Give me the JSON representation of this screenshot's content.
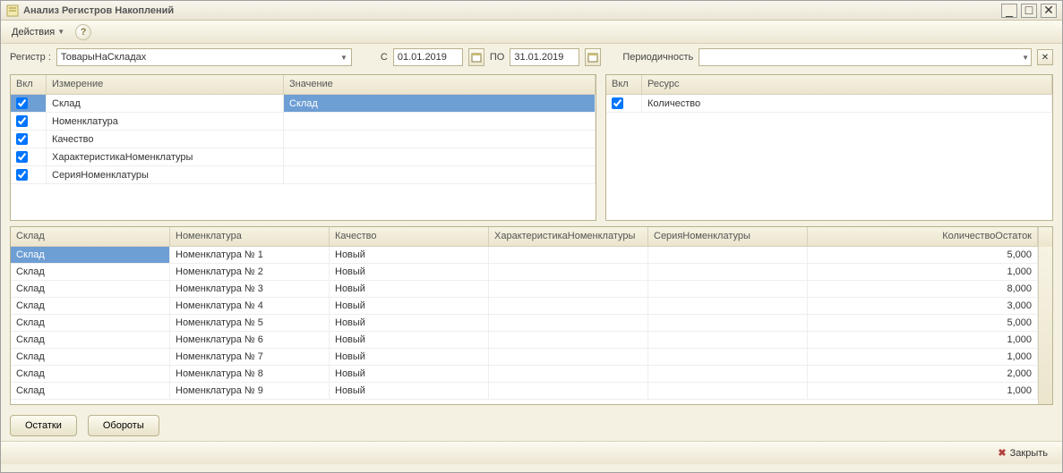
{
  "window": {
    "title": "Анализ Регистров Накоплений"
  },
  "toolbar": {
    "actions_label": "Действия"
  },
  "filter": {
    "register_label": "Регистр :",
    "register_value": "ТоварыНаСкладах",
    "from_label": "С",
    "date_from": "01.01.2019",
    "to_label": "ПО",
    "date_to": "31.01.2019",
    "periodicity_label": "Периодичность"
  },
  "dimensions_grid": {
    "col_vkl": "Вкл",
    "col_izm": "Измерение",
    "col_zn": "Значение",
    "rows": [
      {
        "izm": "Склад",
        "zn": "Склад",
        "selected": true
      },
      {
        "izm": "Номенклатура",
        "zn": ""
      },
      {
        "izm": "Качество",
        "zn": ""
      },
      {
        "izm": "ХарактеристикаНоменклатуры",
        "zn": ""
      },
      {
        "izm": "СерияНоменклатуры",
        "zn": ""
      }
    ]
  },
  "resources_grid": {
    "col_vkl": "Вкл",
    "col_res": "Ресурс",
    "rows": [
      {
        "res": "Количество"
      }
    ]
  },
  "data_grid": {
    "cols": {
      "sklad": "Склад",
      "nomen": "Номенклатура",
      "kach": "Качество",
      "char": "ХарактеристикаНоменклатуры",
      "ser": "СерияНоменклатуры",
      "qty": "КоличествоОстаток"
    },
    "rows": [
      {
        "sklad": "Склад",
        "nomen": "Номенклатура № 1",
        "kach": "Новый",
        "char": "",
        "ser": "",
        "qty": "5,000",
        "selected": true
      },
      {
        "sklad": "Склад",
        "nomen": "Номенклатура № 2",
        "kach": "Новый",
        "char": "",
        "ser": "",
        "qty": "1,000"
      },
      {
        "sklad": "Склад",
        "nomen": "Номенклатура № 3",
        "kach": "Новый",
        "char": "",
        "ser": "",
        "qty": "8,000"
      },
      {
        "sklad": "Склад",
        "nomen": "Номенклатура № 4",
        "kach": "Новый",
        "char": "",
        "ser": "",
        "qty": "3,000"
      },
      {
        "sklad": "Склад",
        "nomen": "Номенклатура № 5",
        "kach": "Новый",
        "char": "",
        "ser": "",
        "qty": "5,000"
      },
      {
        "sklad": "Склад",
        "nomen": "Номенклатура № 6",
        "kach": "Новый",
        "char": "",
        "ser": "",
        "qty": "1,000"
      },
      {
        "sklad": "Склад",
        "nomen": "Номенклатура № 7",
        "kach": "Новый",
        "char": "",
        "ser": "",
        "qty": "1,000"
      },
      {
        "sklad": "Склад",
        "nomen": "Номенклатура № 8",
        "kach": "Новый",
        "char": "",
        "ser": "",
        "qty": "2,000"
      },
      {
        "sklad": "Склад",
        "nomen": "Номенклатура № 9",
        "kach": "Новый",
        "char": "",
        "ser": "",
        "qty": "1,000"
      }
    ]
  },
  "buttons": {
    "ostatki": "Остатки",
    "oboroty": "Обороты",
    "close": "Закрыть"
  }
}
